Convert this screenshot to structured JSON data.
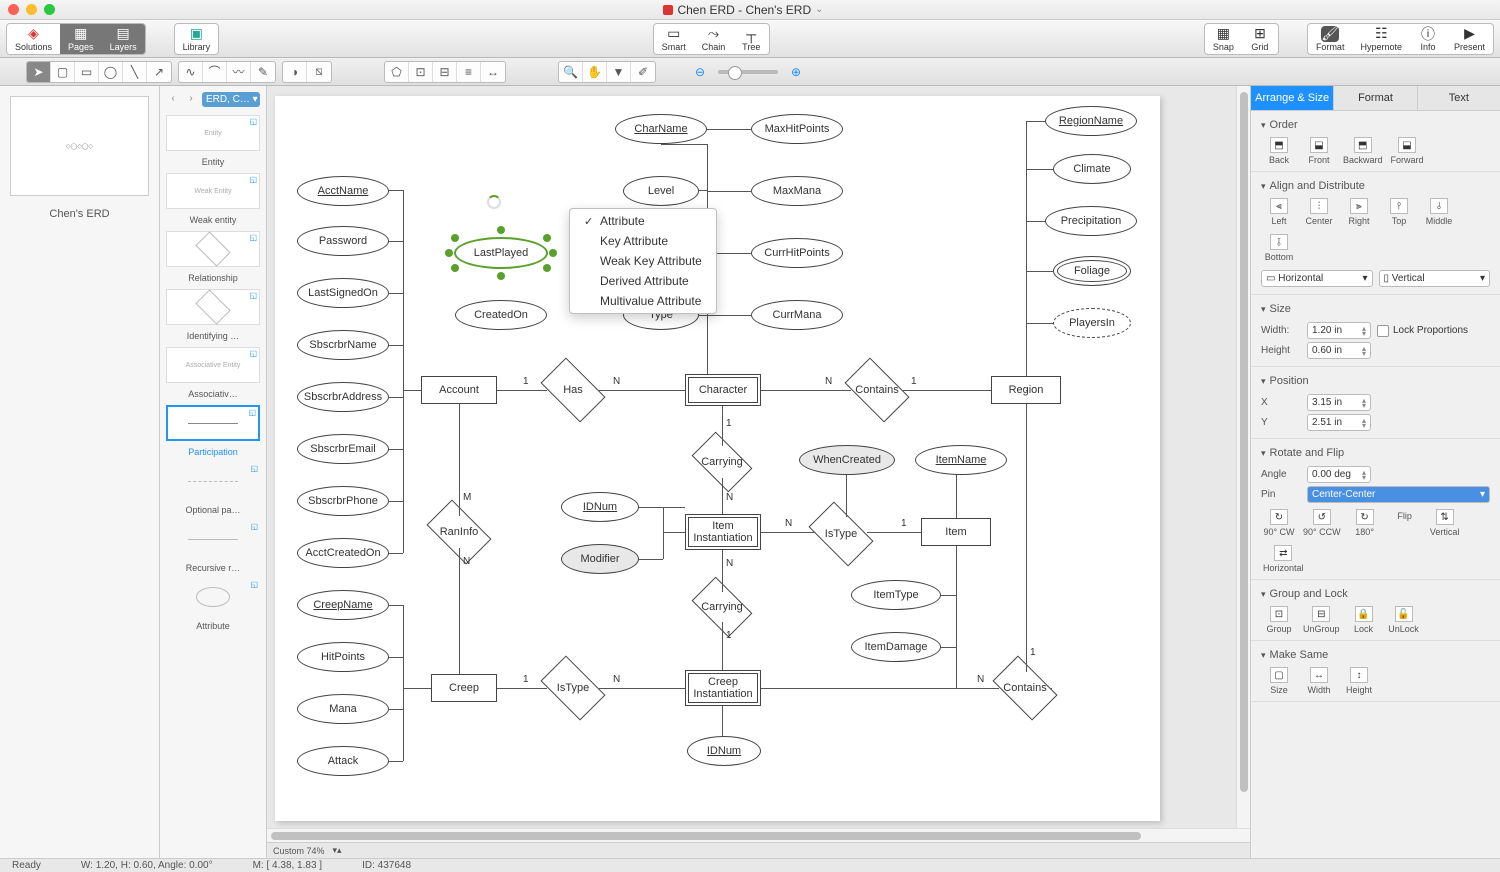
{
  "window": {
    "title": "Chen ERD - Chen's ERD"
  },
  "mainToolbar": {
    "left": [
      {
        "label": "Solutions",
        "icon": "◆"
      },
      {
        "label": "Pages",
        "icon": "▦",
        "selected": true
      },
      {
        "label": "Layers",
        "icon": "▤",
        "selected": true
      }
    ],
    "library": {
      "label": "Library",
      "icon": "▣"
    },
    "center": [
      {
        "label": "Smart",
        "icon": "▭"
      },
      {
        "label": "Chain",
        "icon": "⤳"
      },
      {
        "label": "Tree",
        "icon": "┬"
      }
    ],
    "right": [
      {
        "label": "Snap",
        "icon": "▦"
      },
      {
        "label": "Grid",
        "icon": "⊞"
      }
    ],
    "far": [
      {
        "label": "Format",
        "icon": "🎨"
      },
      {
        "label": "Hypernote",
        "icon": "☷"
      },
      {
        "label": "Info",
        "icon": "ⓘ"
      },
      {
        "label": "Present",
        "icon": "▶"
      }
    ]
  },
  "thumb": {
    "label": "Chen's ERD"
  },
  "library": {
    "selector": "ERD, C…",
    "items": [
      {
        "label": "Entity",
        "preview": "Entity"
      },
      {
        "label": "Weak entity",
        "preview": "Weak Entity"
      },
      {
        "label": "Relationship",
        "preview": "Relationship"
      },
      {
        "label": "Identifying …",
        "preview": "Relationship"
      },
      {
        "label": "Associativ…",
        "preview": "Associative Entity"
      },
      {
        "label": "Participation",
        "preview": "",
        "selected": true
      },
      {
        "label": "Optional pa…",
        "preview": ""
      },
      {
        "label": "Recursive r…",
        "preview": ""
      },
      {
        "label": "Attribute",
        "preview": "Attribute"
      }
    ]
  },
  "contextMenu": {
    "items": [
      {
        "label": "Attribute",
        "checked": true
      },
      {
        "label": "Key Attribute"
      },
      {
        "label": "Weak Key Attribute"
      },
      {
        "label": "Derived Attribute"
      },
      {
        "label": "Multivalue Attribute"
      }
    ]
  },
  "diagram": {
    "attrs": {
      "acctName": "AcctName",
      "password": "Password",
      "lastSigned": "LastSignedOn",
      "sbscrbrName": "SbscrbrName",
      "sbscrbrAddr": "SbscrbrAddress",
      "sbscrbrEmail": "SbscrbrEmail",
      "sbscrbrPhone": "SbscrbrPhone",
      "acctCreated": "AcctCreatedOn",
      "lastPlayed": "LastPlayed",
      "createdOn": "CreatedOn",
      "charName": "CharName",
      "level": "Level",
      "type": "Type",
      "maxHit": "MaxHitPoints",
      "maxMana": "MaxMana",
      "currHit": "CurrHitPoints",
      "currMana": "CurrMana",
      "regionName": "RegionName",
      "climate": "Climate",
      "precip": "Precipitation",
      "foliage": "Foliage",
      "playersIn": "PlayersIn",
      "idNum1": "IDNum",
      "modifier": "Modifier",
      "whenCreated": "WhenCreated",
      "itemName": "ItemName",
      "itemType": "ItemType",
      "itemDamage": "ItemDamage",
      "creepName": "CreepName",
      "hitPoints": "HitPoints",
      "mana": "Mana",
      "attack": "Attack",
      "idNum2": "IDNum",
      "ranInfo": "RanInfo"
    },
    "ents": {
      "account": "Account",
      "character": "Character",
      "region": "Region",
      "itemInst": "Item\nInstantiation",
      "item": "Item",
      "creep": "Creep",
      "creepInst": "Creep\nInstantiation"
    },
    "rels": {
      "has": "Has",
      "contains1": "Contains",
      "carrying1": "Carrying",
      "carrying2": "Carrying",
      "isType1": "IsType",
      "isType2": "IsType",
      "contains2": "Contains"
    },
    "cards": {
      "k1": "1",
      "kN": "N",
      "kM": "M"
    }
  },
  "panel": {
    "tabs": [
      "Arrange & Size",
      "Format",
      "Text"
    ],
    "order": {
      "title": "Order",
      "btns": [
        "Back",
        "Front",
        "Backward",
        "Forward"
      ]
    },
    "align": {
      "title": "Align and Distribute",
      "btns": [
        "Left",
        "Center",
        "Right",
        "Top",
        "Middle",
        "Bottom"
      ],
      "horizontal": "Horizontal",
      "vertical": "Vertical"
    },
    "size": {
      "title": "Size",
      "width_l": "Width:",
      "height_l": "Height",
      "width_v": "1.20 in",
      "height_v": "0.60 in",
      "lock": "Lock Proportions"
    },
    "pos": {
      "title": "Position",
      "x_l": "X",
      "y_l": "Y",
      "x_v": "3.15 in",
      "y_v": "2.51 in"
    },
    "rotate": {
      "title": "Rotate and Flip",
      "angle_l": "Angle",
      "angle_v": "0.00 deg",
      "pin_l": "Pin",
      "pin_v": "Center-Center",
      "btns": [
        "90° CW",
        "90° CCW",
        "180°",
        "Flip",
        "Vertical",
        "Horizontal"
      ]
    },
    "group": {
      "title": "Group and Lock",
      "btns": [
        "Group",
        "UnGroup",
        "Lock",
        "UnLock"
      ]
    },
    "same": {
      "title": "Make Same",
      "btns": [
        "Size",
        "Width",
        "Height"
      ]
    }
  },
  "zoomControl": {
    "label": "Custom 74%"
  },
  "status": {
    "ready": "Ready",
    "size": "W: 1.20,  H: 0.60,  Angle: 0.00°",
    "mouse": "M: [ 4.38, 1.83 ]",
    "id": "ID: 437648"
  }
}
